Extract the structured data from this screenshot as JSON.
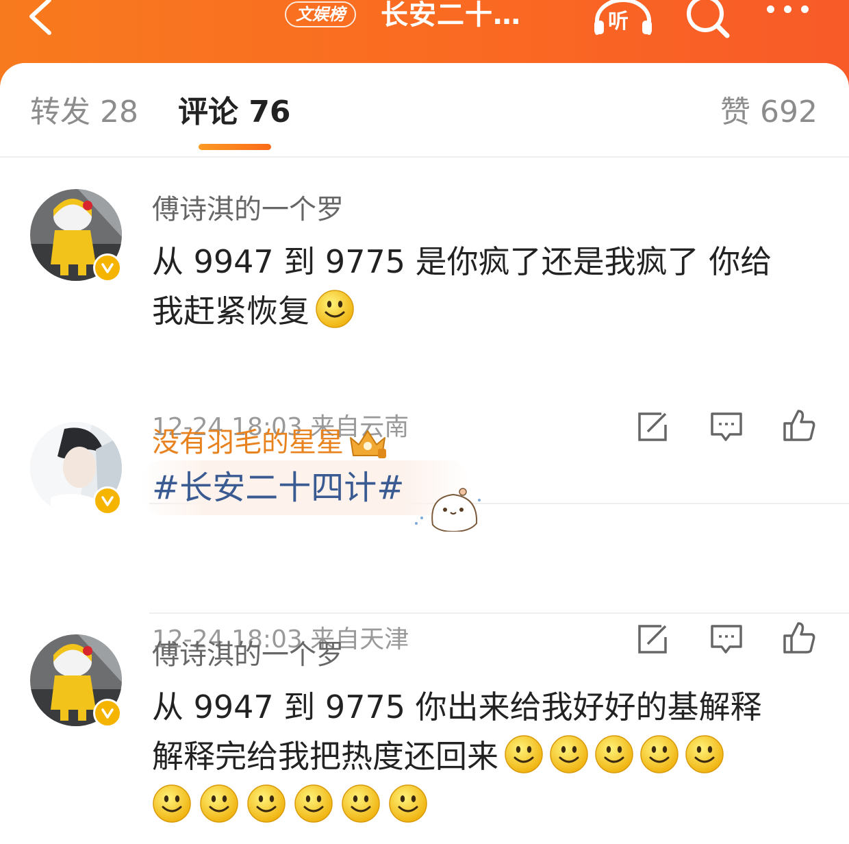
{
  "header": {
    "badge": "文娱榜",
    "title": "长安二十…",
    "listen_label": "听",
    "colors": {
      "bg_start": "#f87a1e",
      "bg_end": "#f85a28"
    },
    "icons": {
      "back": "chevron-left-icon",
      "search": "search-icon",
      "more": "more-dots-icon",
      "listen": "headphones-icon"
    }
  },
  "tabs": {
    "repost": "转发 28",
    "comment": "评论 76",
    "like": "赞 692",
    "active": "comment"
  },
  "comments": [
    {
      "username": "傅诗淇的一个罗",
      "text_lines": [
        "从 9947 到 9775 是你疯了还是我疯了 你给",
        "我赶紧恢复"
      ],
      "emoji_count": 1,
      "time": "12-24 18:03",
      "location": "来自云南"
    },
    {
      "username": "没有羽毛的星星",
      "hashtag": "#长安二十四计#",
      "time": "12-24 18:03",
      "location": "来自天津"
    },
    {
      "username": "傅诗淇的一个罗",
      "text_lines": [
        "从 9947 到 9775 你出来给我好好的基解释",
        "解释完给我把热度还回来"
      ],
      "emoji_count": 11
    }
  ]
}
